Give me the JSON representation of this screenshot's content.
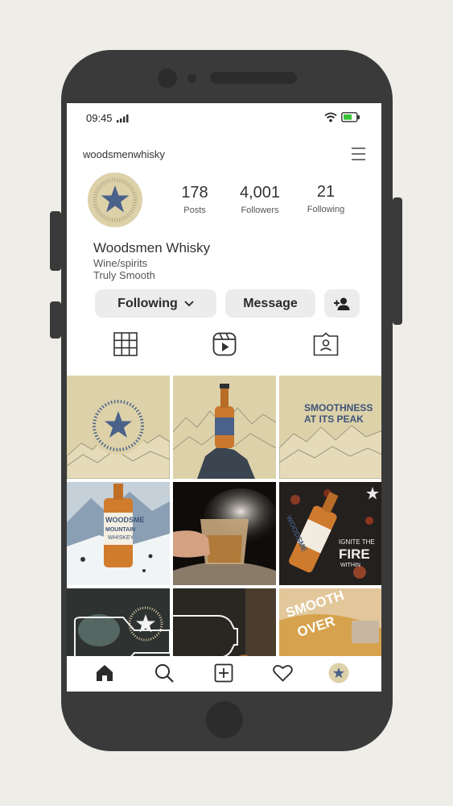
{
  "status_bar": {
    "time": "09:45"
  },
  "profile": {
    "username": "woodsmenwhisky",
    "name": "Woodsmen Whisky",
    "category": "Wine/spirits",
    "bio": "Truly Smooth",
    "avatar_ring_text": "MOST MAJESTIC LIKE THE STARS · THE HEART OF THE WOODLANDS ·"
  },
  "stats": [
    {
      "value": "178",
      "label": "Posts"
    },
    {
      "value": "4,001",
      "label": "Followers"
    },
    {
      "value": "21",
      "label": "Following"
    }
  ],
  "actions": {
    "following_label": "Following",
    "message_label": "Message"
  },
  "posts": {
    "p3_text_1": "SMOOTHNESS",
    "p3_text_2": "AT ITS PEAK",
    "p4_label_1": "WOODSME",
    "p4_label_2": "MOUNTAIN",
    "p4_label_3": "WHISKEY",
    "p6_text_1": "IGNITE THE",
    "p6_text_2": "FIRE",
    "p6_text_3": "WITHIN",
    "p6_label": "WOODSME",
    "p9_text_1": "SMOOTH",
    "p9_text_2": "OVER"
  },
  "colors": {
    "brand_blue": "#4a6189",
    "cream": "#ddd1a9",
    "bottle_orange": "#c9782d",
    "phone_body": "#3a3a3a"
  }
}
